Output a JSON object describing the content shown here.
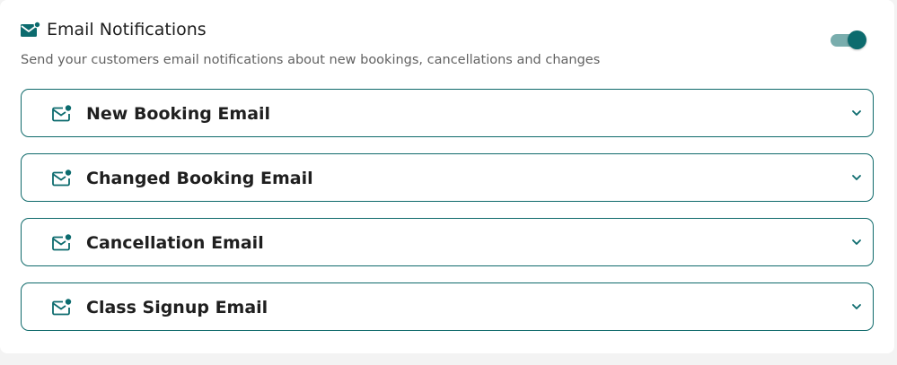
{
  "header": {
    "title": "Email Notifications",
    "subtitle": "Send your customers email notifications about new bookings, cancellations and changes",
    "icon": "mail-notification-icon",
    "toggle_on": true
  },
  "items": [
    {
      "label": "New Booking Email",
      "icon": "mail-notification-icon"
    },
    {
      "label": "Changed Booking Email",
      "icon": "mail-notification-icon"
    },
    {
      "label": "Cancellation Email",
      "icon": "mail-notification-icon"
    },
    {
      "label": "Class Signup Email",
      "icon": "mail-notification-icon"
    }
  ],
  "colors": {
    "accent": "#0c6b6e",
    "toggle_track": "#79adad",
    "border": "#0f6a6b"
  }
}
